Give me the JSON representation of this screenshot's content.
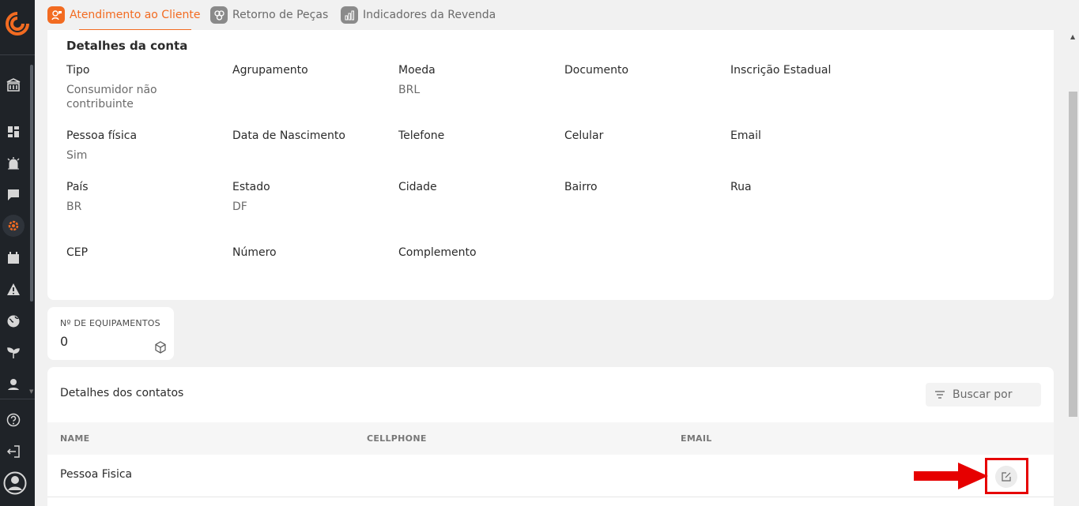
{
  "tabs": [
    {
      "label": "Atendimento ao Cliente",
      "icon": "customer-service-icon",
      "active": true
    },
    {
      "label": "Retorno de Peças",
      "icon": "parts-return-icon",
      "active": false
    },
    {
      "label": "Indicadores da Revenda",
      "icon": "bar-chart-icon",
      "active": false
    }
  ],
  "account": {
    "title": "Detalhes da conta",
    "fields": {
      "tipo": {
        "label": "Tipo",
        "value": "Consumidor não contribuinte"
      },
      "agrupamento": {
        "label": "Agrupamento",
        "value": ""
      },
      "moeda": {
        "label": "Moeda",
        "value": "BRL"
      },
      "documento": {
        "label": "Documento",
        "value": ""
      },
      "inscricao": {
        "label": "Inscrição Estadual",
        "value": ""
      },
      "pessoa_fisica": {
        "label": "Pessoa física",
        "value": "Sim"
      },
      "nascimento": {
        "label": "Data de Nascimento",
        "value": ""
      },
      "telefone": {
        "label": "Telefone",
        "value": ""
      },
      "celular": {
        "label": "Celular",
        "value": ""
      },
      "email": {
        "label": "Email",
        "value": ""
      },
      "pais": {
        "label": "País",
        "value": "BR"
      },
      "estado": {
        "label": "Estado",
        "value": "DF"
      },
      "cidade": {
        "label": "Cidade",
        "value": ""
      },
      "bairro": {
        "label": "Bairro",
        "value": ""
      },
      "rua": {
        "label": "Rua",
        "value": ""
      },
      "cep": {
        "label": "CEP",
        "value": ""
      },
      "numero": {
        "label": "Número",
        "value": ""
      },
      "complemento": {
        "label": "Complemento",
        "value": ""
      }
    }
  },
  "equipment": {
    "label": "Nº DE EQUIPAMENTOS",
    "value": "0"
  },
  "contacts": {
    "title": "Detalhes dos contatos",
    "search_placeholder": "Buscar por",
    "columns": [
      "NAME",
      "CELLPHONE",
      "EMAIL"
    ],
    "rows": [
      {
        "name": "Pessoa Fisica",
        "cellphone": "",
        "email": ""
      }
    ]
  },
  "colors": {
    "accent": "#f26b21",
    "rail": "#1f2328",
    "highlight": "#e60000"
  }
}
